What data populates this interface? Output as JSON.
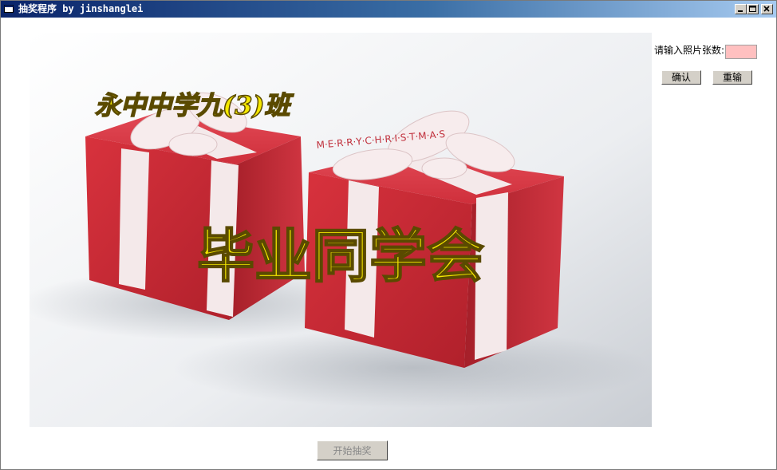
{
  "window": {
    "title": "抽奖程序 by jinshanglei"
  },
  "photo": {
    "line1": "永中中学九(3)班",
    "line2": "毕业同学会",
    "ribbon_text": "M·E·R·R·Y·C·H·R·I·S·T·M·A·S"
  },
  "form": {
    "prompt_label": "请输入照片张数:",
    "count_value": "",
    "ok_label": "确认",
    "reset_label": "重输"
  },
  "footer": {
    "start_label": "开始抽奖"
  },
  "colors": {
    "title_gradient_start": "#0a246a",
    "title_gradient_end": "#a6caf0",
    "input_background": "#ffc0c0",
    "headline_yellow": "#f5e800"
  }
}
